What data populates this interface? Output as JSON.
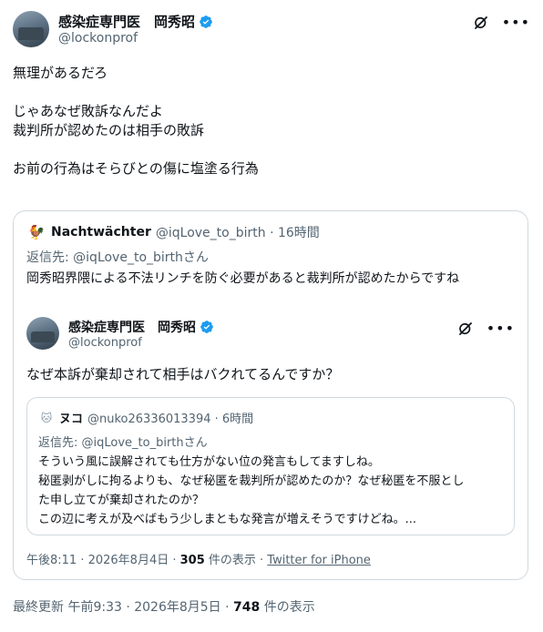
{
  "author": {
    "name": "感染症専門医　岡秀昭",
    "handle": "@lockonprof"
  },
  "colors": {
    "verified": "#1d9bf0",
    "text": "#0f1419",
    "secondary": "#536471",
    "border": "#cfd9de"
  },
  "icons": [
    "verified-badge-icon",
    "grok-icon",
    "more-icon"
  ],
  "tweet": {
    "line1": "無理があるだろ",
    "line2": "じゃあなぜ敗訴なんだよ",
    "line3": "裁判所が認めたのは相手の敗訴",
    "line4": "お前の行為はそらびとの傷に塩塗る行為"
  },
  "quote": {
    "avatar_glyph": "🐓",
    "name": "Nachtwächter",
    "meta": "@iqLove_to_birth · 16時間",
    "reply_to": "返信先: @iqLove_to_birthさん",
    "text": "岡秀昭界隈による不法リンチを防ぐ必要があると裁判所が認めたからですね",
    "inner": {
      "name": "感染症専門医　岡秀昭",
      "handle": "@lockonprof",
      "text": "なぜ本訴が棄却されて相手はバクれてるんですか？",
      "nested": {
        "avatar_glyph": "🐱",
        "name": "ヌコ",
        "meta": "@nuko26336013394 · 6時間",
        "reply_to": "返信先: @iqLove_to_birthさん",
        "line1": "そういう風に誤解されても仕方がない位の発言もしてますしね。",
        "line2": "秘匿剥がしに拘るよりも、なぜ秘匿を裁判所が認めたのか？なぜ秘匿を不服とし",
        "line3": "た申し立てが棄却されたのか？",
        "line4": "この辺に考えが及べばもう少しまともな発言が増えそうですけどね。..."
      },
      "footer": {
        "time": "午後8:11 · 2026年8月4日 · ",
        "views": "305",
        "views_suffix": " 件の表示 · ",
        "client": "Twitter for iPhone"
      }
    }
  },
  "footer": {
    "updated": "最終更新 午前9:33 · 2026年8月5日 · ",
    "views": "748",
    "views_suffix": " 件の表示"
  }
}
